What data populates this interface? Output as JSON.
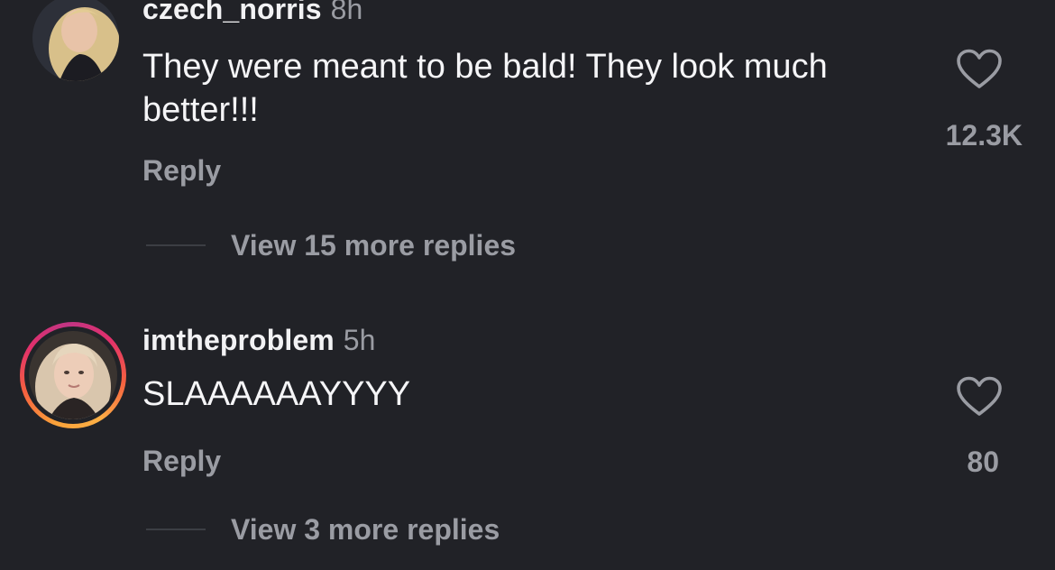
{
  "comments": [
    {
      "username": "czech_norris",
      "time": "8h",
      "text": "They were meant to be bald! They look much better!!!",
      "reply_label": "Reply",
      "likes": "12.3K",
      "view_replies_label": "View 15 more replies",
      "has_story_ring": false
    },
    {
      "username": "imtheproblem",
      "time": "5h",
      "text": "SLAAAAAAYYYY",
      "reply_label": "Reply",
      "likes": "80",
      "view_replies_label": "View 3 more replies",
      "has_story_ring": true
    }
  ],
  "icons": {
    "like": "heart-outline-icon"
  },
  "colors": {
    "background": "#212227",
    "primary_text": "#f5f5f7",
    "secondary_text": "#9a9ca3",
    "story_ring": [
      "#f9a23a",
      "#f56040",
      "#e1306c",
      "#c13584"
    ]
  }
}
